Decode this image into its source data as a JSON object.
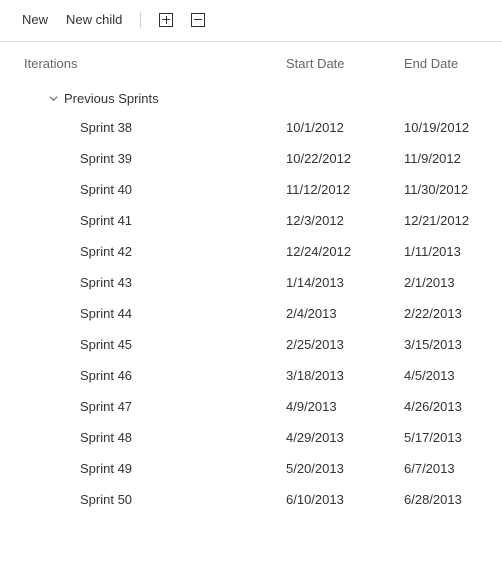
{
  "toolbar": {
    "new_label": "New",
    "new_child_label": "New child",
    "expand_all_label": "Expand all",
    "collapse_all_label": "Collapse all"
  },
  "headers": {
    "iterations": "Iterations",
    "start_date": "Start Date",
    "end_date": "End Date"
  },
  "group": {
    "label": "Previous Sprints",
    "expanded": true
  },
  "sprints": [
    {
      "name": "Sprint 38",
      "start": "10/1/2012",
      "end": "10/19/2012"
    },
    {
      "name": "Sprint 39",
      "start": "10/22/2012",
      "end": "11/9/2012"
    },
    {
      "name": "Sprint 40",
      "start": "11/12/2012",
      "end": "11/30/2012"
    },
    {
      "name": "Sprint 41",
      "start": "12/3/2012",
      "end": "12/21/2012"
    },
    {
      "name": "Sprint 42",
      "start": "12/24/2012",
      "end": "1/11/2013"
    },
    {
      "name": "Sprint 43",
      "start": "1/14/2013",
      "end": "2/1/2013"
    },
    {
      "name": "Sprint 44",
      "start": "2/4/2013",
      "end": "2/22/2013"
    },
    {
      "name": "Sprint 45",
      "start": "2/25/2013",
      "end": "3/15/2013"
    },
    {
      "name": "Sprint 46",
      "start": "3/18/2013",
      "end": "4/5/2013"
    },
    {
      "name": "Sprint 47",
      "start": "4/9/2013",
      "end": "4/26/2013"
    },
    {
      "name": "Sprint 48",
      "start": "4/29/2013",
      "end": "5/17/2013"
    },
    {
      "name": "Sprint 49",
      "start": "5/20/2013",
      "end": "6/7/2013"
    },
    {
      "name": "Sprint 50",
      "start": "6/10/2013",
      "end": "6/28/2013"
    }
  ]
}
